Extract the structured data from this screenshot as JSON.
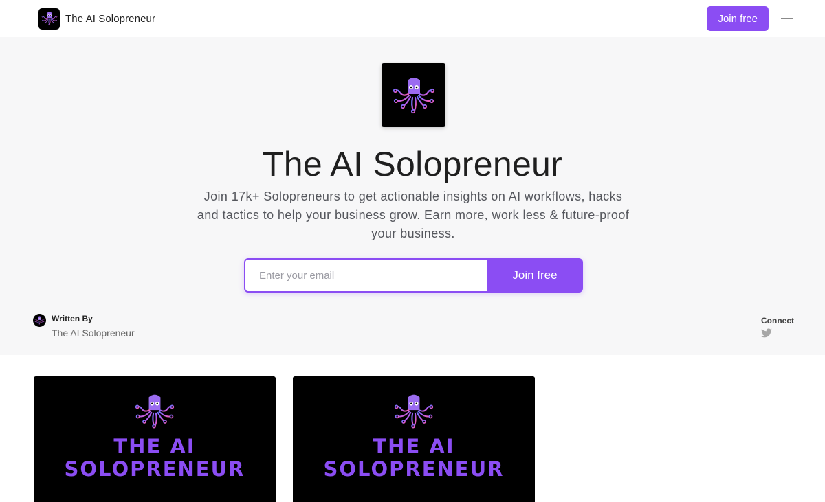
{
  "nav": {
    "brand_name": "The AI Solopreneur",
    "join_label": "Join free",
    "menu_icon": "hamburger-icon"
  },
  "hero": {
    "title": "The AI Solopreneur",
    "description": "Join 17k+ Solopreneurs to get actionable insights on AI workflows, hacks and tactics to help your business grow. Earn more, work less & future-proof your business.",
    "email_placeholder": "Enter your email",
    "email_value": "",
    "signup_label": "Join free"
  },
  "author": {
    "label": "Written By",
    "name": "The AI Solopreneur"
  },
  "connect": {
    "label": "Connect",
    "icon": "twitter-icon"
  },
  "posts": [
    {
      "title_line1": "THE AI",
      "title_line2": "SOLOPRENEUR"
    },
    {
      "title_line1": "THE AI",
      "title_line2": "SOLOPRENEUR"
    }
  ],
  "colors": {
    "accent": "#8b4df3",
    "hero_bg": "#f7f7f8",
    "logo_bg": "#000000"
  }
}
